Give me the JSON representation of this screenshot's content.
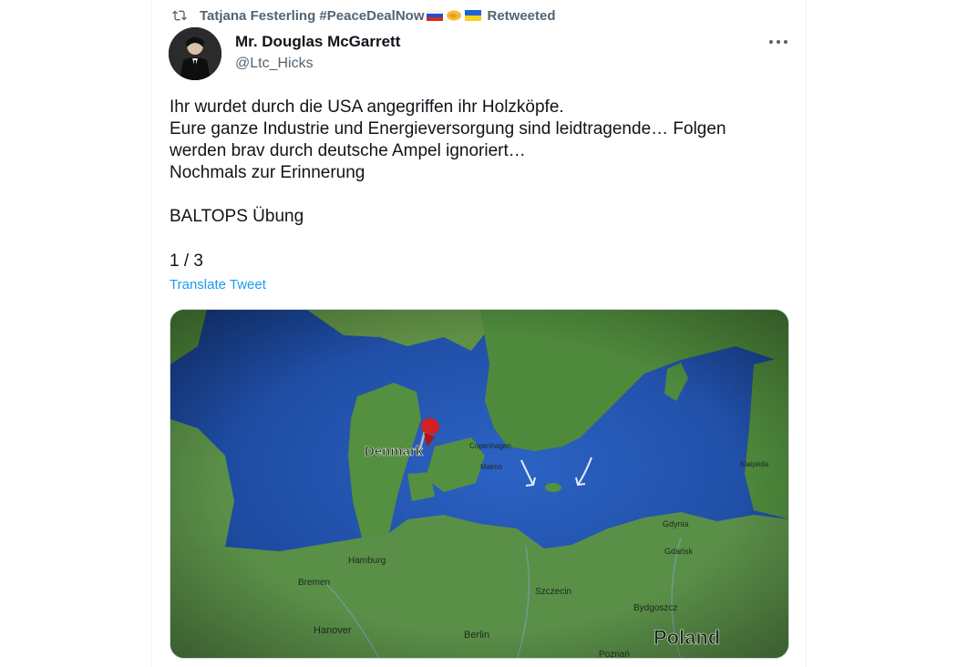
{
  "retweet": {
    "user": "Tatjana Festerling #PeaceDealNow",
    "emojis": [
      "russia-flag",
      "handshake",
      "ukraine-flag"
    ],
    "label": "Retweeted"
  },
  "author": {
    "name": "Mr. Douglas McGarrett",
    "handle": "@Ltc_Hicks"
  },
  "tweet": {
    "lines": [
      "Ihr wurdet durch die USA angegriffen ihr Holzköpfe.",
      "Eure ganze Industrie und Energieversorgung sind leidtragende… Folgen",
      "werden brav durch deutsche Ampel ignoriert…",
      "Nochmals zur Erinnerung",
      "",
      "BALTOPS Übung"
    ],
    "counter": "1 / 3",
    "translate_label": "Translate Tweet"
  },
  "map": {
    "labels": {
      "denmark": "Denmark",
      "copenhagen": "Copenhagen",
      "malmo": "Malmö",
      "hamburg": "Hamburg",
      "bremen": "Bremen",
      "hanover": "Hanover",
      "berlin": "Berlin",
      "szczecin": "Szczecin",
      "gdynia": "Gdynia",
      "gdansk": "Gdańsk",
      "bydgoszcz": "Bydgoszcz",
      "poland": "Poland",
      "poznan": "Poznań",
      "klaipeda": "Klaipėda"
    }
  },
  "colors": {
    "link": "#1d9bf0",
    "secondary_text": "#536471",
    "sea": "#1f4ea8",
    "land": "#4f8a3c"
  }
}
